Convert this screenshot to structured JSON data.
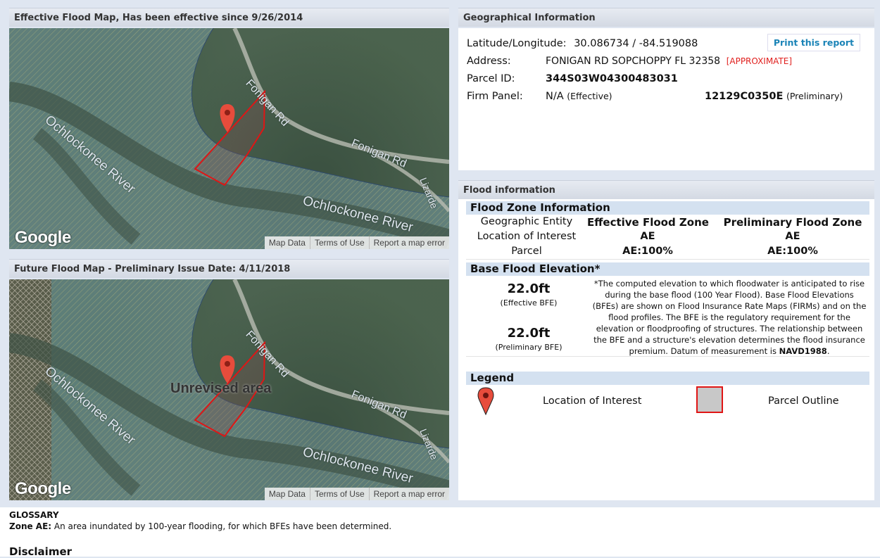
{
  "effective_map": {
    "title": "Effective Flood Map, Has been effective since 9/26/2014",
    "labels": {
      "river1": "Ochlockonee River",
      "river2": "Ochlockonee River",
      "road1": "Fonigan Rd",
      "road2": "Fonigan Rd",
      "road3": "Lizarde"
    },
    "google": "Google",
    "footer": [
      "Map Data",
      "Terms of Use",
      "Report a map error"
    ]
  },
  "future_map": {
    "title": "Future Flood Map - Preliminary Issue Date: 4/11/2018",
    "labels": {
      "river1": "Ochlockonee River",
      "river2": "Ochlockonee River",
      "road1": "Fonigan Rd",
      "road2": "Fonigan Rd",
      "road3": "Lizarde"
    },
    "overlay": "Unrevised area",
    "google": "Google",
    "footer": [
      "Map Data",
      "Terms of Use",
      "Report a map error"
    ]
  },
  "geo": {
    "title": "Geographical Information",
    "print": "Print this report",
    "latlon_label": "Latitude/Longitude:",
    "latlon_value": "30.086734 / -84.519088",
    "address_label": "Address:",
    "address_value": "FONIGAN RD SOPCHOPPY FL 32358",
    "address_note": "[APPROXIMATE]",
    "parcel_label": "Parcel ID:",
    "parcel_value": "344S03W04300483031",
    "firm_label": "Firm Panel:",
    "firm_eff": "N/A",
    "firm_eff_note": "(Effective)",
    "firm_pre": "12129C0350E",
    "firm_pre_note": "(Preliminary)"
  },
  "flood": {
    "title": "Flood information",
    "zone_title": "Flood Zone Information",
    "col_entity": "Geographic Entity",
    "col_eff": "Effective Flood Zone",
    "col_pre": "Preliminary Flood Zone",
    "row1_label": "Location of Interest",
    "row1_eff": "AE",
    "row1_pre": "AE",
    "row2_label": "Parcel",
    "row2_eff": "AE:100%",
    "row2_pre": "AE:100%",
    "bfe_title": "Base Flood Elevation*",
    "bfe_eff": "22.0ft",
    "bfe_eff_note": "(Effective BFE)",
    "bfe_pre": "22.0ft",
    "bfe_pre_note": "(Preliminary BFE)",
    "bfe_desc": "*The computed elevation to which floodwater is anticipated to rise during the base flood (100 Year Flood). Base Flood Elevations (BFEs) are shown on Flood Insurance Rate Maps (FIRMs) and on the flood profiles. The BFE is the regulatory requirement for the elevation or floodproofing of structures. The relationship between the BFE and a structure's elevation determines the flood insurance premium. Datum of measurement is",
    "bfe_datum": "NAVD1988",
    "legend_title": "Legend",
    "legend_loc": "Location of Interest",
    "legend_parcel": "Parcel Outline"
  },
  "glossary": {
    "title": "GLOSSARY",
    "zone_term": "Zone AE:",
    "zone_def": "An area inundated by 100-year flooding, for which BFEs have been determined."
  },
  "disclaimer": {
    "title": "Disclaimer"
  }
}
